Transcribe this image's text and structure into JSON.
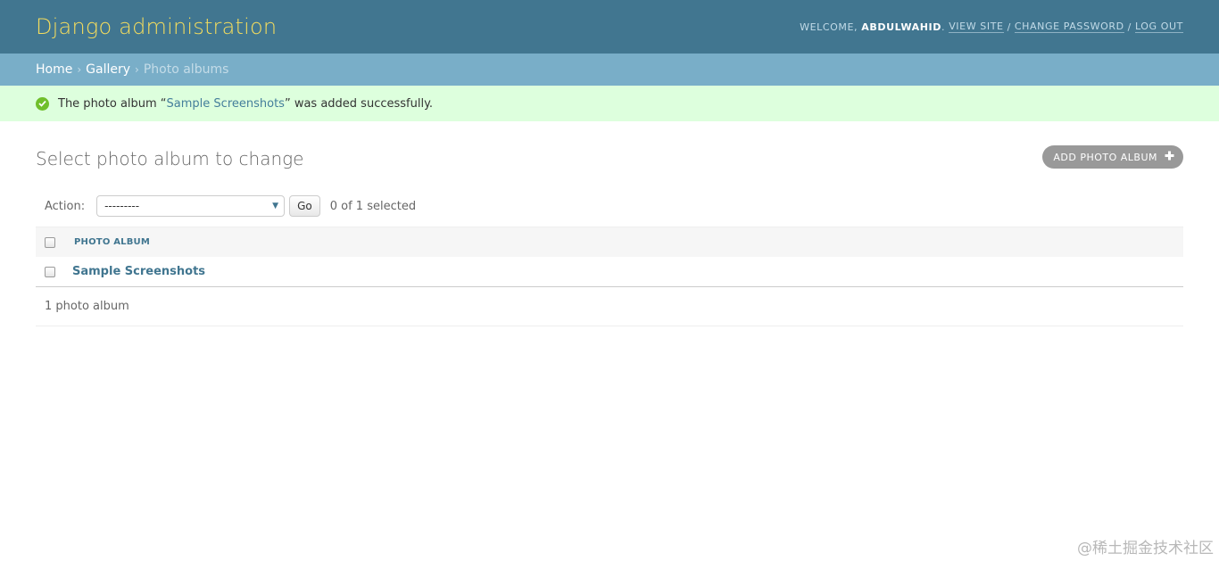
{
  "header": {
    "site_name": "Django administration",
    "welcome": "Welcome,",
    "username": "abdulwahid",
    "view_site": "View site",
    "change_password": "Change password",
    "log_out": "Log out"
  },
  "breadcrumbs": {
    "home": "Home",
    "gallery": "Gallery",
    "current": "Photo albums",
    "separator": "›"
  },
  "message": {
    "prefix": "The photo album “",
    "album": "Sample Screenshots",
    "suffix": "” was added successfully.",
    "icon": "check-circle-icon"
  },
  "content": {
    "title": "Select photo album to change",
    "add_button": "Add photo album",
    "action_label": "Action:",
    "action_selected": "---------",
    "go_button": "Go",
    "selection_count": "0 of 1 selected",
    "column_header": "Photo album",
    "rows": [
      {
        "name": "Sample Screenshots"
      }
    ],
    "paginator": "1 photo album"
  },
  "watermark": "@稀土掘金技术社区",
  "colors": {
    "header_bg": "#417690",
    "site_name": "#f5dd5d",
    "breadcrumbs_bg": "#79aec8",
    "success_bg": "#ddffdd",
    "link": "#417690",
    "add_button_bg": "#999999"
  }
}
